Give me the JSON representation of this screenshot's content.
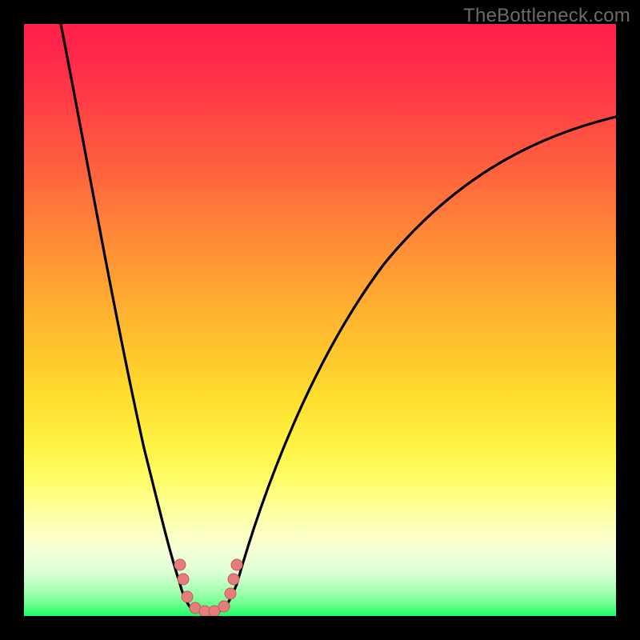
{
  "watermark": "TheBottleneck.com",
  "colors": {
    "frame": "#000000",
    "curve": "#000000",
    "marker_fill": "#e77c7c",
    "marker_stroke": "#c55a5a",
    "gradient_top": "#ff1f49",
    "gradient_mid": "#ffde2e",
    "gradient_bottom": "#1aff62",
    "watermark": "#6b6b6b"
  },
  "chart_data": {
    "type": "line",
    "title": "",
    "xlabel": "",
    "ylabel": "",
    "xlim": [
      0,
      100
    ],
    "ylim": [
      0,
      100
    ],
    "grid": false,
    "legend": false,
    "background": "vertical-gradient red→orange→yellow→green",
    "series": [
      {
        "name": "bottleneck-curve",
        "x": [
          6,
          10,
          15,
          20,
          24,
          26,
          28,
          30,
          32,
          34,
          36,
          40,
          48,
          58,
          70,
          85,
          100
        ],
        "values": [
          100,
          80,
          58,
          38,
          18,
          8,
          2,
          0,
          1,
          4,
          10,
          24,
          44,
          62,
          76,
          83,
          85
        ]
      }
    ],
    "markers": {
      "name": "highlighted-points",
      "note": "salmon dots clustered near curve minimum",
      "x": [
        25,
        26,
        27,
        28,
        29,
        31,
        33,
        34,
        35,
        36
      ],
      "values": [
        9,
        7,
        4,
        1,
        0,
        0,
        1,
        3,
        6,
        9
      ]
    }
  }
}
